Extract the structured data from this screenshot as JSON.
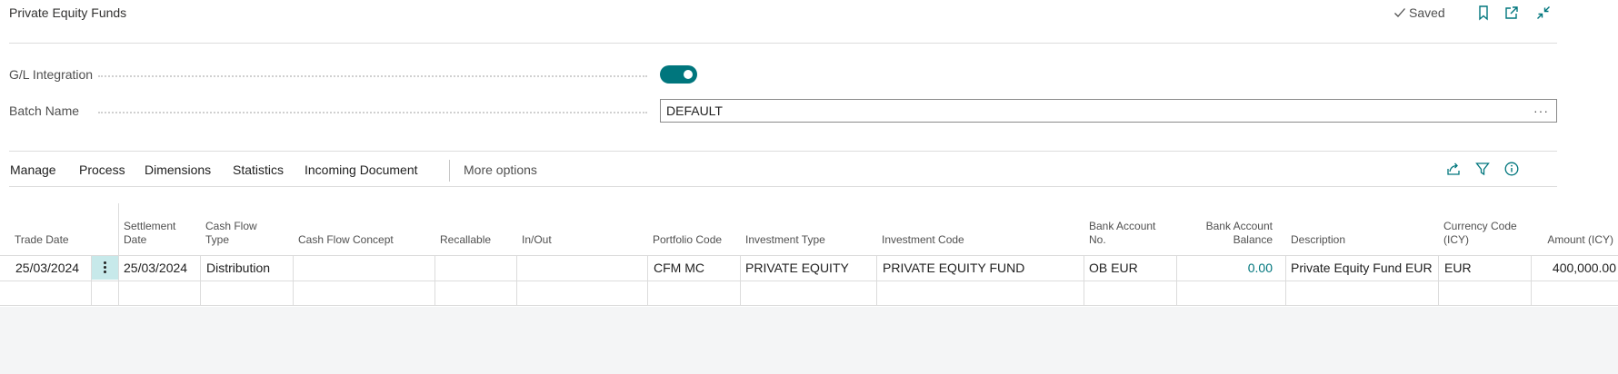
{
  "header": {
    "title": "Private Equity Funds",
    "saved_label": "Saved",
    "icons": [
      "checkmark-icon",
      "bookmark-icon",
      "open-new-window-icon",
      "collapse-icon"
    ]
  },
  "fields": {
    "gl_integration": {
      "label": "G/L Integration",
      "value": true
    },
    "batch_name": {
      "label": "Batch Name",
      "value": "DEFAULT",
      "lookup": "···"
    }
  },
  "actions": {
    "items": [
      "Manage",
      "Process",
      "Dimensions",
      "Statistics",
      "Incoming Document"
    ],
    "more": "More options",
    "icons": [
      "share-icon",
      "filter-icon",
      "info-icon"
    ]
  },
  "grid": {
    "columns": {
      "trade_date": "Trade Date",
      "settlement_date": [
        "Settlement",
        "Date"
      ],
      "cash_flow_type": [
        "Cash Flow",
        "Type"
      ],
      "cash_flow_concept": "Cash Flow Concept",
      "recallable": "Recallable",
      "in_out": "In/Out",
      "portfolio_code": "Portfolio Code",
      "investment_type": "Investment Type",
      "investment_code": "Investment Code",
      "bank_account_no": [
        "Bank Account",
        "No."
      ],
      "bank_account_balance": [
        "Bank Account",
        "Balance"
      ],
      "description": "Description",
      "currency_code": [
        "Currency Code",
        "(ICY)"
      ],
      "amount_icy": "Amount (ICY)"
    },
    "rows": [
      {
        "trade_date": "25/03/2024",
        "settlement_date": "25/03/2024",
        "cash_flow_type": "Distribution",
        "cash_flow_concept": "",
        "recallable": "",
        "in_out": "",
        "portfolio_code": "CFM MC",
        "investment_type": "PRIVATE EQUITY",
        "investment_code": "PRIVATE EQUITY FUND",
        "bank_account_no": "OB EUR",
        "bank_account_balance": "0.00",
        "description": "Private Equity Fund EUR",
        "currency_code": "EUR",
        "amount_icy": "400,000.00"
      }
    ]
  },
  "colors": {
    "accent": "#00767d",
    "row_menu_bg": "#c7e9ea",
    "footer_bg": "#f4f5f6"
  }
}
